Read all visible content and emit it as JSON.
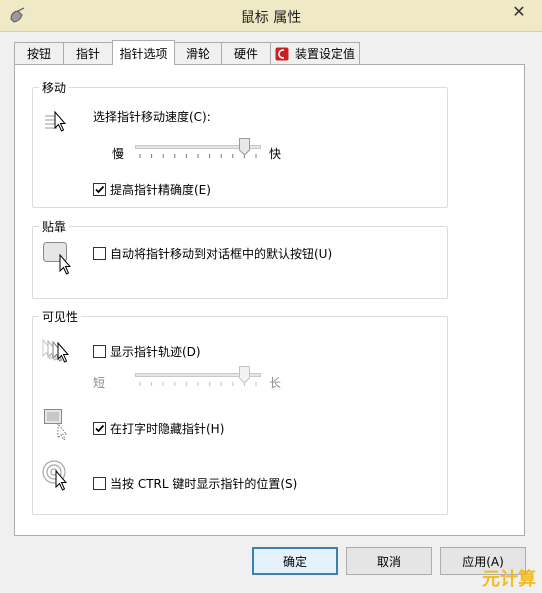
{
  "window": {
    "title": "鼠标 属性",
    "close_label": "✕"
  },
  "tabs": [
    {
      "label": "按钮"
    },
    {
      "label": "指针"
    },
    {
      "label": "指针选项",
      "active": true
    },
    {
      "label": "滑轮"
    },
    {
      "label": "硬件"
    },
    {
      "label": "装置设定值"
    }
  ],
  "motion": {
    "title": "移动",
    "speed_label": "选择指针移动速度(C):",
    "slow": "慢",
    "fast": "快",
    "speed_level": 0.9,
    "precision_label": "提高指针精确度(E)",
    "precision_checked": true
  },
  "snap": {
    "title": "贴靠",
    "snap_label": "自动将指针移动到对话框中的默认按钮(U)",
    "snap_checked": false
  },
  "visibility": {
    "title": "可见性",
    "trails_label": "显示指针轨迹(D)",
    "trails_checked": false,
    "short": "短",
    "long": "长",
    "trails_level": 0.9,
    "hide_label": "在打字时隐藏指针(H)",
    "hide_checked": true,
    "ctrl_label": "当按 CTRL 键时显示指针的位置(S)",
    "ctrl_checked": false
  },
  "buttons": {
    "ok": "确定",
    "cancel": "取消",
    "apply": "应用(A)"
  },
  "watermark": "元计算",
  "colors": {
    "titlebar": "#f0e9c5",
    "accent": "#3c7fb1",
    "tab_icon_red": "#cc1f1f"
  }
}
